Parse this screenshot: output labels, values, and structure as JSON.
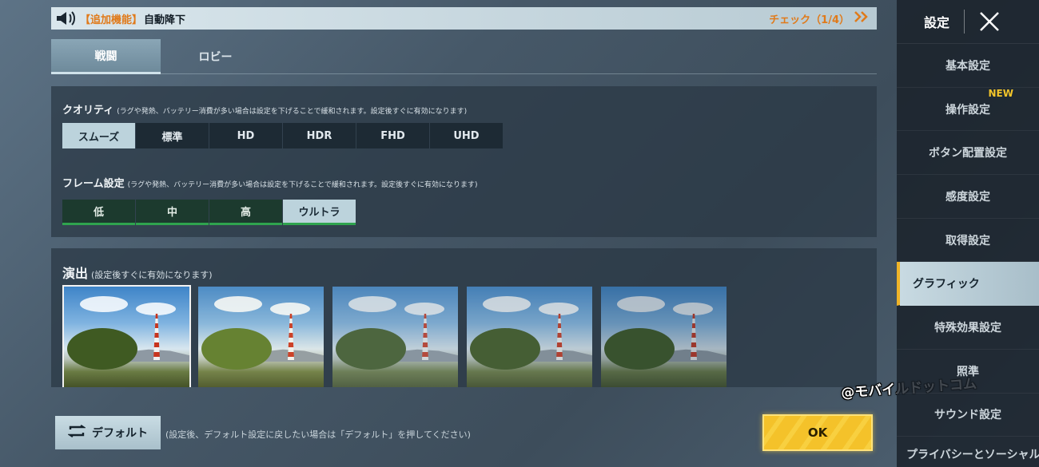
{
  "notice": {
    "tag": "【追加機能】",
    "title": "自動降下",
    "check_label": "チェック（1/4）",
    "icons": {
      "left": "speaker-icon",
      "right": "double-chevron-right-icon"
    }
  },
  "tabs": [
    {
      "label": "戦闘",
      "active": true
    },
    {
      "label": "ロビー",
      "active": false
    }
  ],
  "quality": {
    "label": "クオリティ",
    "note": "(ラグや発熱、バッテリー消費が多い場合は設定を下げることで緩和されます。設定後すぐに有効になります)",
    "options": [
      "スムーズ",
      "標準",
      "HD",
      "HDR",
      "FHD",
      "UHD"
    ],
    "selected": "スムーズ"
  },
  "frame": {
    "label": "フレーム設定",
    "note": "(ラグや発熱、バッテリー消費が多い場合は設定を下げることで緩和されます。設定後すぐに有効になります)",
    "options": [
      "低",
      "中",
      "高",
      "ウルトラ"
    ],
    "selected": "ウルトラ"
  },
  "effect": {
    "label": "演出",
    "note": "(設定後すぐに有効になります)",
    "thumbnails": 5,
    "selected_index": 0
  },
  "footer": {
    "default_label": "デフォルト",
    "default_hint": "(設定後、デフォルト設定に戻したい場合は「デフォルト」を押してください)",
    "ok_label": "OK"
  },
  "watermark": "@モバイルドットコム",
  "sidebar": {
    "title": "設定",
    "new_badge": "NEW",
    "items": [
      {
        "label": "基本設定"
      },
      {
        "label": "操作設定",
        "badge": true
      },
      {
        "label": "ボタン配置設定"
      },
      {
        "label": "感度設定"
      },
      {
        "label": "取得設定"
      },
      {
        "label": "グラフィック",
        "active": true
      },
      {
        "label": "特殊効果設定"
      },
      {
        "label": "照準"
      },
      {
        "label": "サウンド設定"
      },
      {
        "label": "プライバシーとソーシャル"
      }
    ]
  },
  "colors": {
    "accent": "#f0b428",
    "ok": "#f4c22a",
    "frame_bar": "#2fa34e",
    "notice_tag": "#e07a1a"
  }
}
